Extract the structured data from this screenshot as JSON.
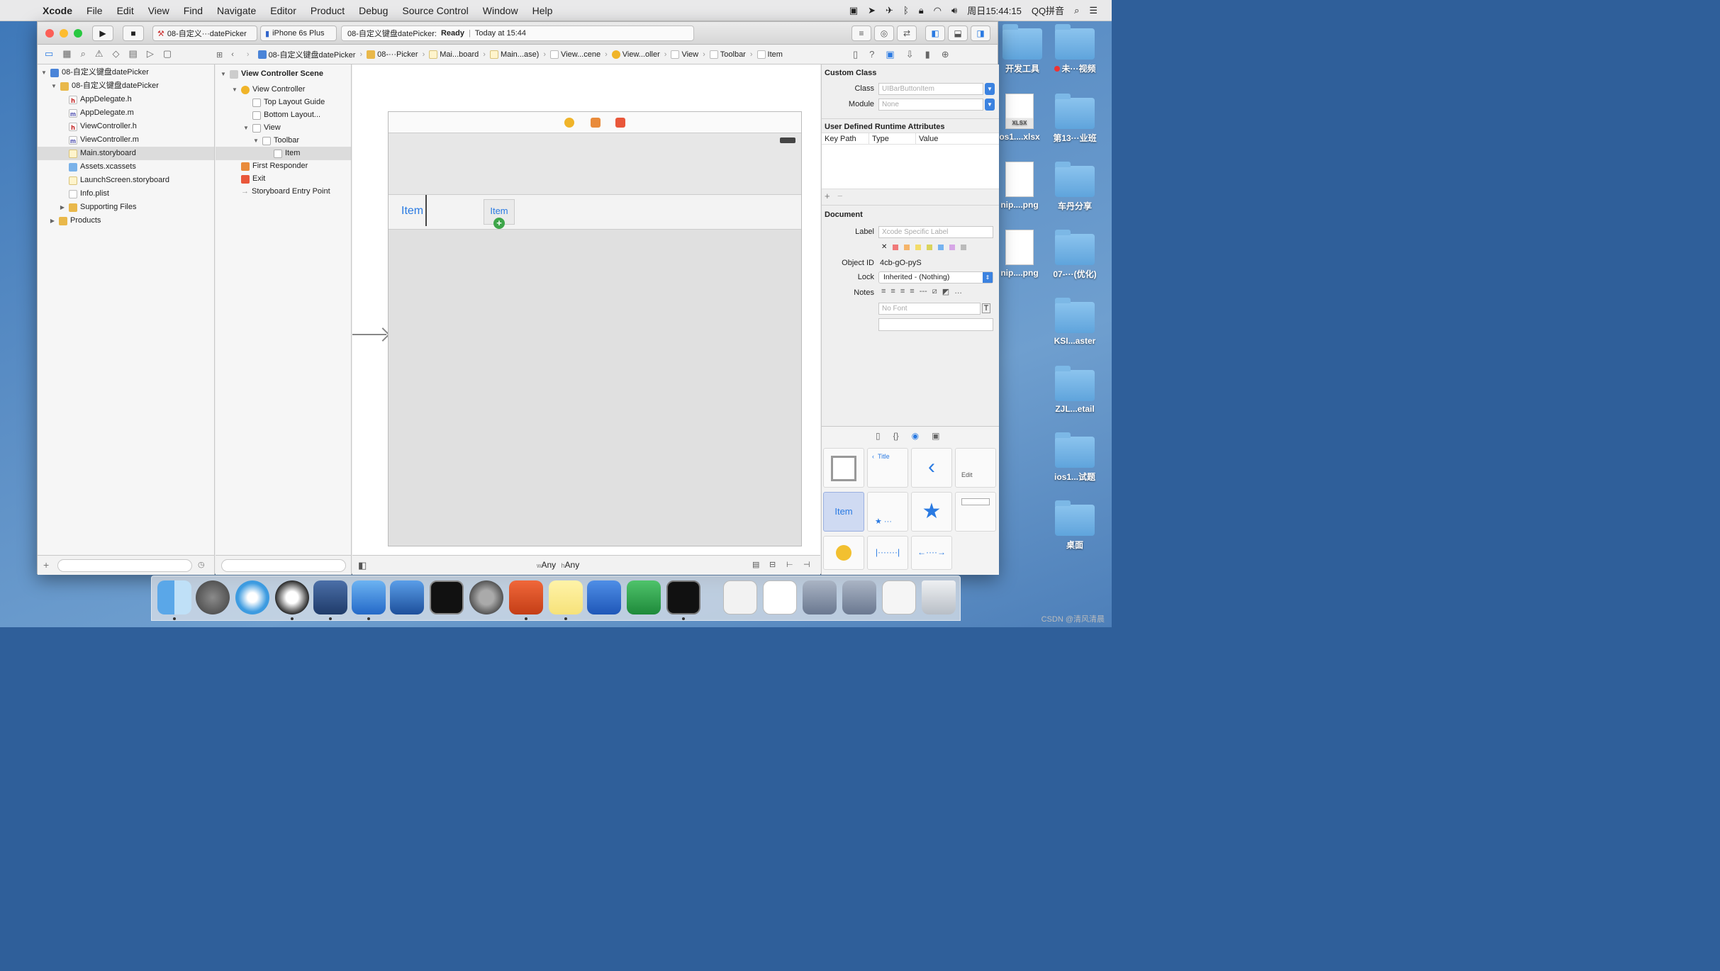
{
  "menubar": {
    "app": "Xcode",
    "items": [
      "File",
      "Edit",
      "View",
      "Find",
      "Navigate",
      "Editor",
      "Product",
      "Debug",
      "Source Control",
      "Window",
      "Help"
    ],
    "clock": "周日15:44:15",
    "input_method": "QQ拼音"
  },
  "toolbar": {
    "scheme": "08-自定义···datePicker",
    "device": "iPhone 6s Plus",
    "status_project": "08-自定义键盘datePicker:",
    "status_state": "Ready",
    "status_time": "Today at 15:44"
  },
  "jumpbar": [
    "08-自定义键盘datePicker",
    "08-···Picker",
    "Mai...board",
    "Main...ase)",
    "View...cene",
    "View...oller",
    "View",
    "Toolbar",
    "Item"
  ],
  "navigator": {
    "project": "08-自定义键盘datePicker",
    "group": "08-自定义键盘datePicker",
    "files": [
      "AppDelegate.h",
      "AppDelegate.m",
      "ViewController.h",
      "ViewController.m",
      "Main.storyboard",
      "Assets.xcassets",
      "LaunchScreen.storyboard",
      "Info.plist",
      "Supporting Files",
      "Products"
    ]
  },
  "outline": {
    "scene": "View Controller Scene",
    "vc": "View Controller",
    "top_guide": "Top Layout Guide",
    "bottom_guide": "Bottom Layout...",
    "view": "View",
    "toolbar": "Toolbar",
    "item": "Item",
    "first_responder": "First Responder",
    "exit": "Exit",
    "entry": "Storyboard Entry Point"
  },
  "canvas": {
    "item_label": "Item",
    "dragged_label": "Item",
    "size_class_w": "Any",
    "size_class_h": "Any"
  },
  "inspector": {
    "custom_class_title": "Custom Class",
    "class_label": "Class",
    "class_placeholder": "UIBarButtonItem",
    "module_label": "Module",
    "module_placeholder": "None",
    "runtime_title": "User Defined Runtime Attributes",
    "col_key": "Key Path",
    "col_type": "Type",
    "col_value": "Value",
    "document_title": "Document",
    "label_label": "Label",
    "label_placeholder": "Xcode Specific Label",
    "object_id_label": "Object ID",
    "object_id": "4cb-gO-pyS",
    "lock_label": "Lock",
    "lock_value": "Inherited - (Nothing)",
    "notes_label": "Notes",
    "font_placeholder": "No Font"
  },
  "library": {
    "item_cell": "Item",
    "title_cell": "Title",
    "edit_cell": "Edit"
  },
  "desktop": {
    "icons": [
      "开发工具",
      "未···视频",
      "os1....xlsx",
      "第13···业班",
      "nip....png",
      "车丹分享",
      "nip....png",
      "07-···(优化)",
      "KSI...aster",
      "ZJL...etail",
      "ios1...试题",
      "桌面"
    ],
    "xlsx_tag": "XLSX"
  },
  "watermark": "CSDN @清风清晨"
}
